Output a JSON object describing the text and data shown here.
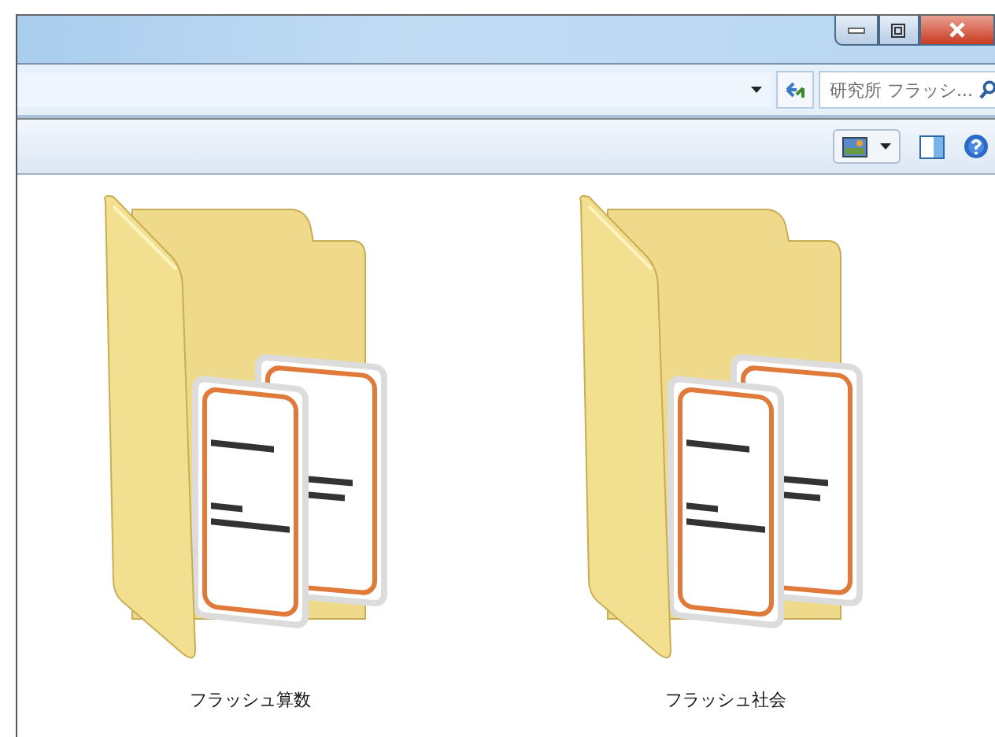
{
  "search": {
    "value": "研究所 フラッシ..."
  },
  "folders": [
    {
      "name": "フラッシュ算数"
    },
    {
      "name": "フラッシュ社会"
    }
  ]
}
